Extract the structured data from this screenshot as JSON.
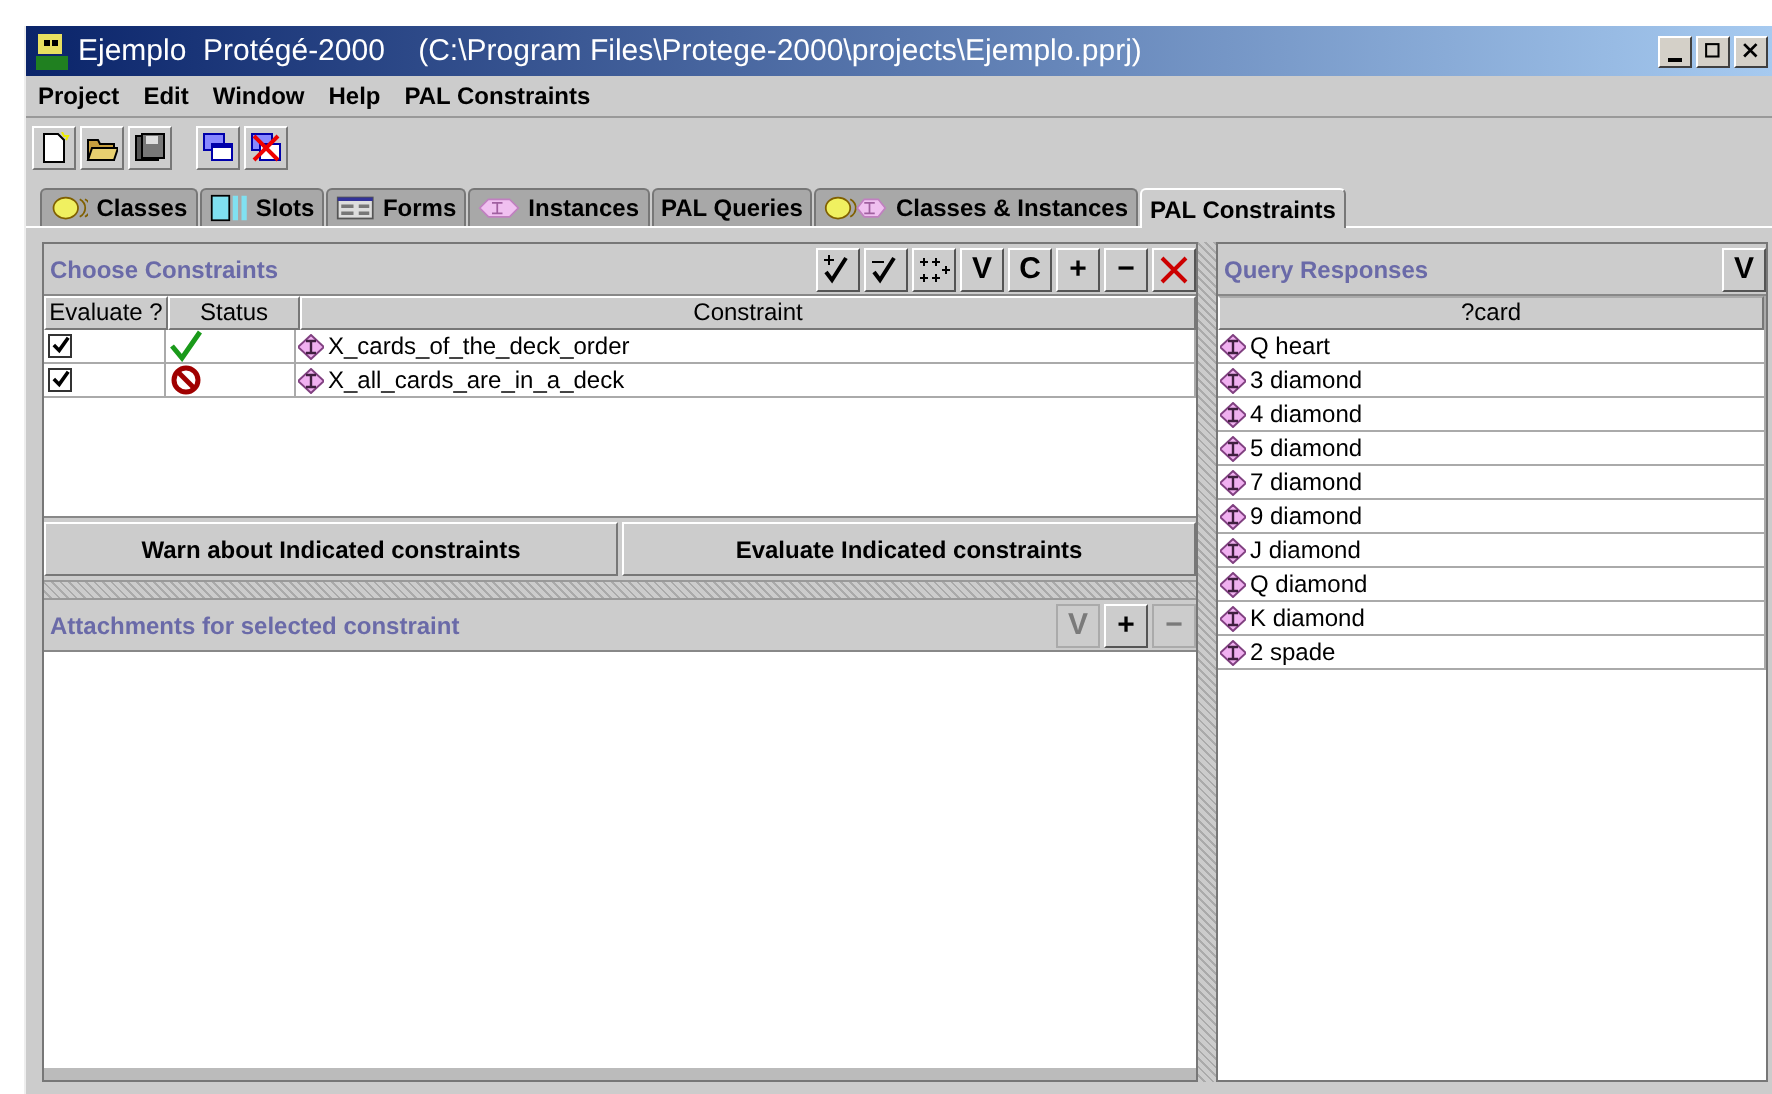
{
  "window": {
    "title": "Ejemplo  Protégé-2000    (C:\\Program Files\\Protege-2000\\projects\\Ejemplo.pprj)"
  },
  "menu": [
    "Project",
    "Edit",
    "Window",
    "Help",
    "PAL Constraints"
  ],
  "tabs": [
    {
      "label": "Classes",
      "kind": "class",
      "selected": false
    },
    {
      "label": "Slots",
      "kind": "slot",
      "selected": false
    },
    {
      "label": "Forms",
      "kind": "form",
      "selected": false
    },
    {
      "label": "Instances",
      "kind": "instance",
      "selected": false
    },
    {
      "label": "PAL Queries",
      "kind": "plain",
      "selected": false
    },
    {
      "label": "Classes & Instances",
      "kind": "both",
      "selected": false
    },
    {
      "label": "PAL Constraints",
      "kind": "plain",
      "selected": true
    }
  ],
  "constraints_panel": {
    "title": "Choose Constraints",
    "tools": [
      {
        "kind": "check-plus",
        "disabled": false
      },
      {
        "kind": "check-minus",
        "disabled": false
      },
      {
        "kind": "plus-grid",
        "disabled": false
      },
      {
        "kind": "text",
        "label": "V",
        "disabled": false
      },
      {
        "kind": "text",
        "label": "C",
        "disabled": false
      },
      {
        "kind": "text",
        "label": "+",
        "disabled": false
      },
      {
        "kind": "text",
        "label": "−",
        "disabled": false
      },
      {
        "kind": "delete",
        "disabled": false
      }
    ],
    "columns": [
      "Evaluate ?",
      "Status",
      "Constraint"
    ],
    "rows": [
      {
        "evaluate": true,
        "satisfied": true,
        "constraint": "X_cards_of_the_deck_order"
      },
      {
        "evaluate": true,
        "satisfied": false,
        "constraint": "X_all_cards_are_in_a_deck"
      }
    ],
    "buttons": [
      "Warn about Indicated constraints",
      "Evaluate Indicated constraints"
    ]
  },
  "attachments_panel": {
    "title": "Attachments for selected constraint",
    "tools": [
      {
        "kind": "text",
        "label": "V",
        "disabled": true
      },
      {
        "kind": "text",
        "label": "+",
        "disabled": false
      },
      {
        "kind": "text",
        "label": "−",
        "disabled": true
      }
    ]
  },
  "responses_panel": {
    "title": "Query Responses",
    "tools": [
      {
        "kind": "text",
        "label": "V",
        "disabled": false
      }
    ],
    "column": "?card",
    "rows": [
      "Q heart",
      "3 diamond",
      "4 diamond",
      "5 diamond",
      "7 diamond",
      "9 diamond",
      "J diamond",
      "Q diamond",
      "K diamond",
      "2 spade"
    ]
  }
}
